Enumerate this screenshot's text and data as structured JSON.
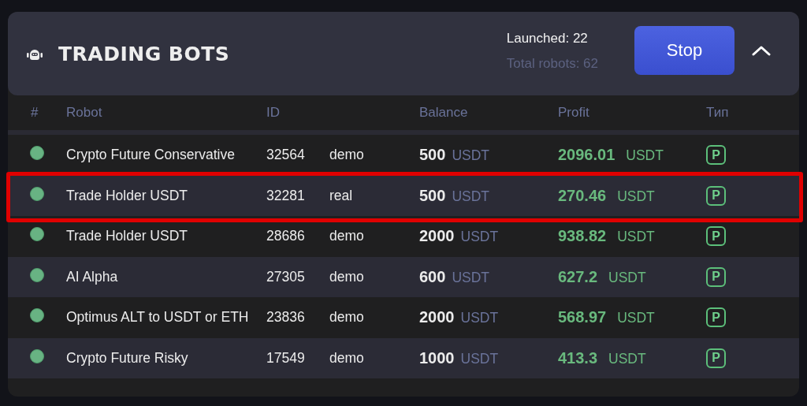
{
  "header": {
    "title": "TRADING BOTS",
    "launched": "Launched: 22",
    "total": "Total robots: 62",
    "stop_button": "Stop",
    "expanded": true
  },
  "table": {
    "columns": [
      "#",
      "Robot",
      "ID",
      "Balance",
      "Profit",
      "Тип"
    ],
    "rows": [
      {
        "active": true,
        "highlighted": false,
        "robot": "Crypto Future Conservative",
        "id": "32564",
        "mode": "demo",
        "balance": "500",
        "balance_unit": "USDT",
        "profit": "2096.01",
        "profit_unit": "USDT",
        "type": "P"
      },
      {
        "active": true,
        "highlighted": true,
        "robot": "Trade Holder USDT",
        "id": "32281",
        "mode": "real",
        "balance": "500",
        "balance_unit": "USDT",
        "profit": "270.46",
        "profit_unit": "USDT",
        "type": "P"
      },
      {
        "active": true,
        "highlighted": false,
        "robot": "Trade Holder USDT",
        "id": "28686",
        "mode": "demo",
        "balance": "2000",
        "balance_unit": "USDT",
        "profit": "938.82",
        "profit_unit": "USDT",
        "type": "P"
      },
      {
        "active": true,
        "highlighted": false,
        "robot": "AI Alpha",
        "id": "27305",
        "mode": "demo",
        "balance": "600",
        "balance_unit": "USDT",
        "profit": "627.2",
        "profit_unit": "USDT",
        "type": "P"
      },
      {
        "active": true,
        "highlighted": false,
        "robot": "Optimus ALT to USDT or ETH",
        "id": "23836",
        "mode": "demo",
        "balance": "2000",
        "balance_unit": "USDT",
        "profit": "568.97",
        "profit_unit": "USDT",
        "type": "P"
      },
      {
        "active": true,
        "highlighted": false,
        "robot": "Crypto Future Risky",
        "id": "17549",
        "mode": "demo",
        "balance": "1000",
        "balance_unit": "USDT",
        "profit": "413.3",
        "profit_unit": "USDT",
        "type": "P"
      }
    ]
  }
}
